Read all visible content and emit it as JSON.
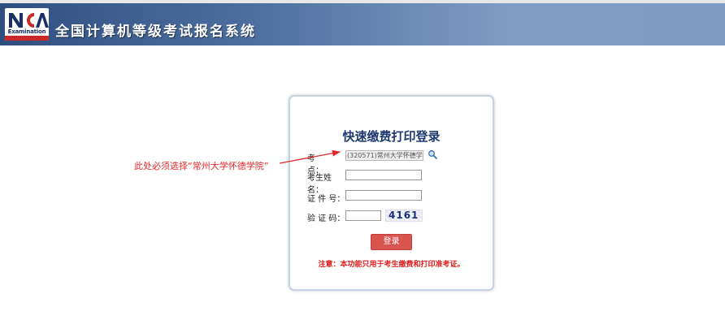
{
  "header": {
    "logo_text": "Examination",
    "title": "全国计算机等级考试报名系统"
  },
  "login": {
    "title": "快速缴费打印登录",
    "exam_site_label": "考　　点：",
    "exam_site_value": "(320571)常州大学怀德学",
    "name_label": "考生姓名：",
    "id_label": "证 件 号：",
    "captcha_label": "验 证 码：",
    "captcha_value": "4161",
    "login_button": "登录",
    "notice": "注意：本功能只用于考生缴费和打印准考证。"
  },
  "annotation": {
    "text": "此处必须选择“常州大学怀德学院”"
  },
  "colors": {
    "header_dark": "#2f4f80",
    "header_light": "#7d9bc3",
    "button": "#d9534f",
    "notice": "#e31a1a",
    "annotation": "#e0282a"
  }
}
